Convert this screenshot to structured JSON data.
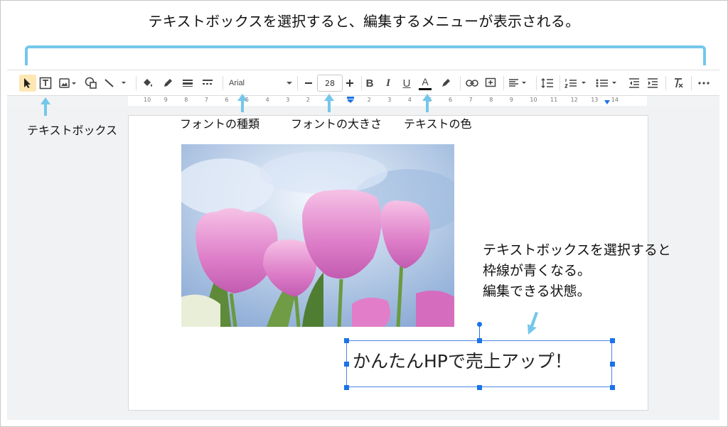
{
  "caption": "テキストボックスを選択すると、編集するメニューが表示される。",
  "toolbar": {
    "font_name": "Arial",
    "font_size": "28",
    "bold_label": "B",
    "italic_label": "I",
    "underline_label": "U",
    "text_color_label": "A"
  },
  "ruler": {
    "ticks": [
      "10",
      "9",
      "8",
      "7",
      "6",
      "5",
      "4",
      "3",
      "2",
      "1",
      "1",
      "2",
      "3",
      "4",
      "5",
      "6",
      "7",
      "8",
      "9",
      "10",
      "11",
      "12",
      "13",
      "14"
    ]
  },
  "annotations": {
    "textbox": "テキストボックス",
    "font_type": "フォントの種類",
    "font_size": "フォントの大きさ",
    "text_color": "テキストの色"
  },
  "note": {
    "line1": "テキストボックスを選択すると",
    "line2": "枠線が青くなる。",
    "line3": "編集できる状態。"
  },
  "slide": {
    "textbox_text": "かんたんHPで売上アップ！"
  },
  "colors": {
    "accent_bracket": "#74c7ea",
    "selection_blue": "#1a73e8",
    "selected_tool_bg": "#fde7b3"
  }
}
